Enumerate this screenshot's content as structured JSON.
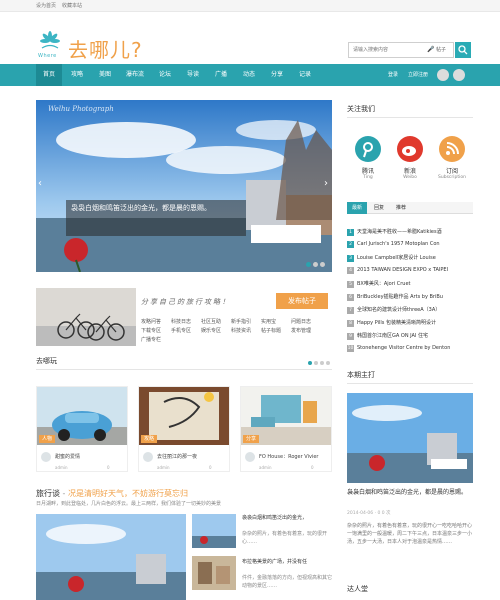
{
  "topbar": {
    "set_home": "设为首页",
    "bookmark": "收藏本站"
  },
  "logo": {
    "sub": "Where",
    "text": "去哪儿?"
  },
  "search": {
    "placeholder": "请输入搜索内容",
    "hint": "帖子"
  },
  "nav": {
    "items": [
      "首页",
      "攻略",
      "美图",
      "瀑布流",
      "论坛",
      "导读",
      "广播",
      "动态",
      "分享",
      "记录"
    ],
    "login": "登录",
    "register": "立即注册"
  },
  "hero": {
    "watermark": "Welhu Photograph",
    "caption": "袅袅白烟和鸣笛泛出的金光，都是晨的恩赐。"
  },
  "banner": {
    "slogan": "分享自己的旅行攻略！",
    "button": "发布帖子",
    "links": [
      "攻略问答",
      "科技日志",
      "社区互助",
      "新手指引",
      "实用宝",
      "问题日志",
      "下载专区",
      "手机专区",
      "娱乐专区",
      "科技资讯",
      "帖子标题",
      "发布管理",
      "广播专栏"
    ]
  },
  "section_go": {
    "title": "去哪玩"
  },
  "cards": [
    {
      "tag": "人物",
      "title": "甜蜜的爱情",
      "meta_user": "admin",
      "meta_count": "0"
    },
    {
      "tag": "攻略",
      "title": "去往丽江的那一夜",
      "meta_user": "admin",
      "meta_count": "0"
    },
    {
      "tag": "分享",
      "title": "FO House：Roger Vivier",
      "meta_user": "admin",
      "meta_count": "0"
    }
  ],
  "story": {
    "label": "旅行谈",
    "dash": " - ",
    "headline": "况是清明好天气，不妨游行莫忘归",
    "sub": "日月湖畔，到此登临处，几片白色的浮云。最上三两样，我们体验了一切美妙的美景"
  },
  "bottom": {
    "items": [
      {
        "title": "袅袅白烟和鸣笛泛出的金光，",
        "text": "杂杂的照片，有着色有着意，玩的很开心……"
      },
      {
        "title": "布拉格美景的广场，并没有任",
        "text": "件件，金融落落的方向，但视观高和其它动物的景区……"
      }
    ]
  },
  "sidebar": {
    "follow_title": "关注我们",
    "socials": [
      {
        "name": "腾讯",
        "en": "Ting"
      },
      {
        "name": "新浪",
        "en": "Weibo"
      },
      {
        "name": "订阅",
        "en": "Subscription"
      }
    ],
    "tabs": [
      "最新",
      "回复",
      "推荐"
    ],
    "news": [
      "天堂海是美不胜收——希腊Katikies酒",
      "Carl Jurisch's 1957 Motoplan Con",
      "Louise Campbell家居设计 Louise",
      "2013 TAIWAN DESIGN EXPO x TAIPEI",
      "BX唯美风：Ajori Cruet",
      "BriBuckley插贴趣作品 Arts by BriBu",
      "全球知名的建筑设计师threeA（3A）",
      "Happy Pills 包装精美清晰简明设计",
      "韩国首尔江南区GA ON JAI 住宅",
      "Stonehenge Visitor Centre by Denton"
    ],
    "weekly_title": "本期主打",
    "weekly_caption": "袅袅白烟和鸣笛泛出的金光，都是晨的恩赐。",
    "weekly_meta": "2014-04-06 · 0 0 次",
    "weekly_text": "杂杂的照片，有着色有着意，玩的很开心一吃吃哈哈开心一饱满里的一般温暖，周二下午三点，日本温泉三步一小汤，五步一大汤，日本人对于泡温泉是热情……",
    "people_title": "达人堂"
  },
  "colors": {
    "accent": "#2aa3ae",
    "orange": "#f0a14a"
  }
}
